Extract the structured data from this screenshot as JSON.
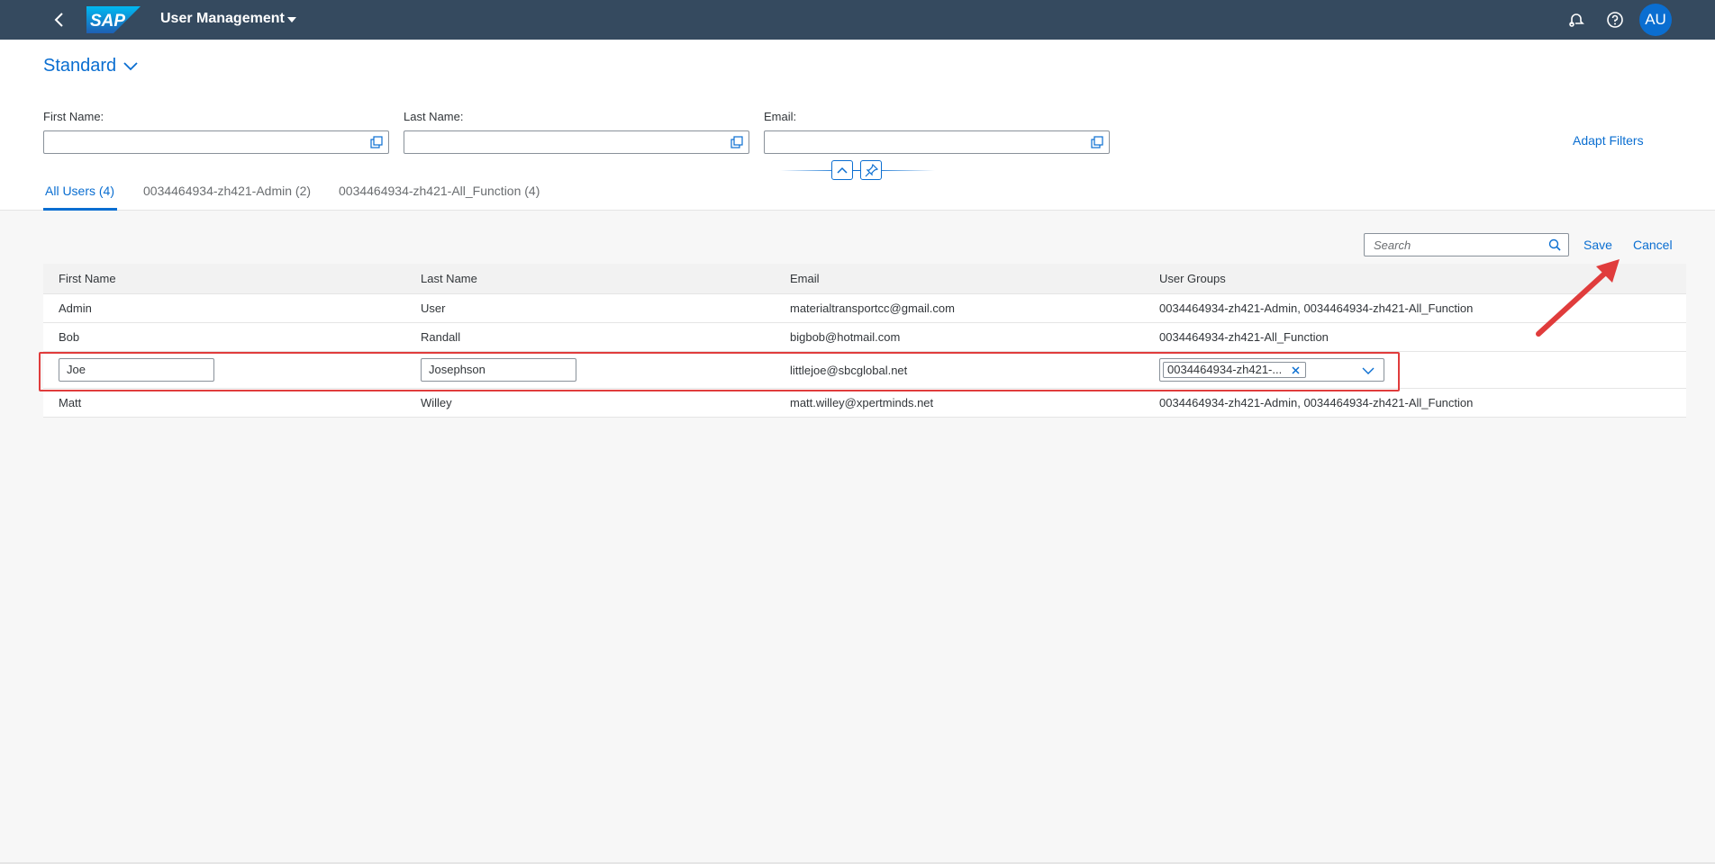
{
  "shell": {
    "logo_text": "SAP",
    "app_title": "User Management",
    "avatar_initials": "AU",
    "icons": [
      "back-icon",
      "sap-logo",
      "caret-down-icon",
      "notification-icon",
      "help-icon"
    ]
  },
  "header": {
    "variant": "Standard",
    "filters": {
      "first_name_label": "First Name:",
      "last_name_label": "Last Name:",
      "email_label": "Email:",
      "first_name_value": "",
      "last_name_value": "",
      "email_value": ""
    },
    "adapt_filters": "Adapt Filters",
    "tabs": [
      {
        "label": "All Users (4)",
        "active": true
      },
      {
        "label": "0034464934-zh421-Admin (2)",
        "active": false
      },
      {
        "label": "0034464934-zh421-All_Function (4)",
        "active": false
      }
    ]
  },
  "toolbar": {
    "search_placeholder": "Search",
    "save_label": "Save",
    "cancel_label": "Cancel"
  },
  "table": {
    "columns": [
      "First Name",
      "Last Name",
      "Email",
      "User Groups"
    ],
    "rows": [
      {
        "first": "Admin",
        "last": "User",
        "email": "materialtransportcc@gmail.com",
        "groups": "0034464934-zh421-Admin, 0034464934-zh421-All_Function"
      },
      {
        "first": "Bob",
        "last": "Randall",
        "email": "bigbob@hotmail.com",
        "groups": "0034464934-zh421-All_Function"
      },
      {
        "first": "Joe",
        "last": "Josephson",
        "email": "littlejoe@sbcglobal.net",
        "groups_token": "0034464934-zh421-...",
        "editing": true
      },
      {
        "first": "Matt",
        "last": "Willey",
        "email": "matt.willey@xpertminds.net",
        "groups": "0034464934-zh421-Admin, 0034464934-zh421-All_Function"
      }
    ]
  },
  "colors": {
    "shell_bg": "#354a5f",
    "accent": "#0a6ed1",
    "highlight": "#e03c3c"
  }
}
